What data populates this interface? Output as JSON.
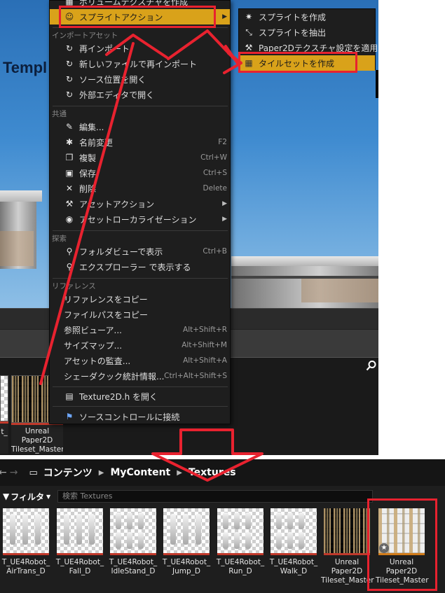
{
  "viewport": {
    "title_fragment": "Templ"
  },
  "context_menu": {
    "top_item": "ボリュームテクスチャを作成",
    "sprite_actions": "スプライトアクション",
    "sections": {
      "import": "インポートアセット",
      "common": "共通",
      "search": "探索",
      "reference": "リファレンス"
    },
    "import_items": [
      "再インポート",
      "新しいファイルで再インポート",
      "ソース位置を開く",
      "外部エディタで開く"
    ],
    "common_items": [
      {
        "label": "編集...",
        "shortcut": ""
      },
      {
        "label": "名前変更",
        "shortcut": "F2"
      },
      {
        "label": "複製",
        "shortcut": "Ctrl+W"
      },
      {
        "label": "保存",
        "shortcut": "Ctrl+S"
      },
      {
        "label": "削除",
        "shortcut": "Delete"
      },
      {
        "label": "アセットアクション",
        "shortcut": ""
      },
      {
        "label": "アセットローカライゼーション",
        "shortcut": ""
      }
    ],
    "search_items": [
      {
        "label": "フォルダビューで表示",
        "shortcut": "Ctrl+B"
      },
      {
        "label": "エクスプローラー で表示する",
        "shortcut": ""
      }
    ],
    "reference_items": [
      {
        "label": "リファレンスをコピー",
        "shortcut": ""
      },
      {
        "label": "ファイルパスをコピー",
        "shortcut": ""
      },
      {
        "label": "参照ビューア...",
        "shortcut": "Alt+Shift+R"
      },
      {
        "label": "サイズマップ...",
        "shortcut": "Alt+Shift+M"
      },
      {
        "label": "アセットの監査...",
        "shortcut": "Alt+Shift+A"
      },
      {
        "label": "シェーダクック統計情報...",
        "shortcut": "Ctrl+Alt+Shift+S"
      }
    ],
    "open_header": "Texture2D.h を開く",
    "source_control": "ソースコントロールに接続"
  },
  "submenu": {
    "items": [
      "スプライトを作成",
      "スプライトを抽出",
      "Paper2Dテクスチャ設定を適用",
      "タイルセットを作成"
    ]
  },
  "top_browser": {
    "left_partial_caption": "t_",
    "tile_caption": [
      "Unreal",
      "Paper2D",
      "Tileset_Master"
    ]
  },
  "bottom_browser": {
    "breadcrumb": [
      "コンテンツ",
      "MyContent",
      "Textures"
    ],
    "filter_label": "フィルタ",
    "search_placeholder": "検索 Textures",
    "assets": [
      {
        "line1": "T_UE4Robot_",
        "line2": "AirTrans_D"
      },
      {
        "line1": "T_UE4Robot_",
        "line2": "Fall_D"
      },
      {
        "line1": "T_UE4Robot_",
        "line2": "IdleStand_D"
      },
      {
        "line1": "T_UE4Robot_",
        "line2": "Jump_D"
      },
      {
        "line1": "T_UE4Robot_",
        "line2": "Run_D"
      },
      {
        "line1": "T_UE4Robot_",
        "line2": "Walk_D"
      },
      {
        "line1": "Unreal",
        "line2": "Paper2D",
        "line3": "Tileset_Master"
      },
      {
        "line1": "Unreal",
        "line2": "Paper2D",
        "line3": "Tileset_Master"
      }
    ]
  },
  "colors": {
    "highlight": "#d9a21a",
    "annotation_red": "#e8222f",
    "menu_bg": "#1e1e1e"
  }
}
